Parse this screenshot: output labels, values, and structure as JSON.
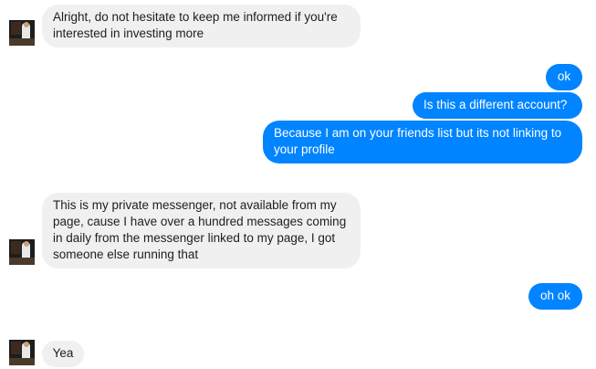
{
  "conversation": {
    "messages": [
      {
        "direction": "incoming",
        "text": "Alright, do not hesitate to keep me informed if you're interested in investing more"
      },
      {
        "direction": "outgoing",
        "text": "ok"
      },
      {
        "direction": "outgoing",
        "text": "Is this a different account?"
      },
      {
        "direction": "outgoing",
        "text": "Because I am on your friends list but its not linking to your profile"
      },
      {
        "direction": "incoming",
        "text": "This is my private messenger, not available from my page, cause I have over a hundred messages coming in daily from the messenger linked  to my page, I got someone else running that"
      },
      {
        "direction": "outgoing",
        "text": "oh ok"
      },
      {
        "direction": "incoming",
        "text": "Yea"
      }
    ]
  },
  "colors": {
    "incoming_bubble": "#f1f0f0",
    "outgoing_bubble": "#0084ff"
  },
  "icons": {
    "avatar": "contact-avatar-icon"
  }
}
